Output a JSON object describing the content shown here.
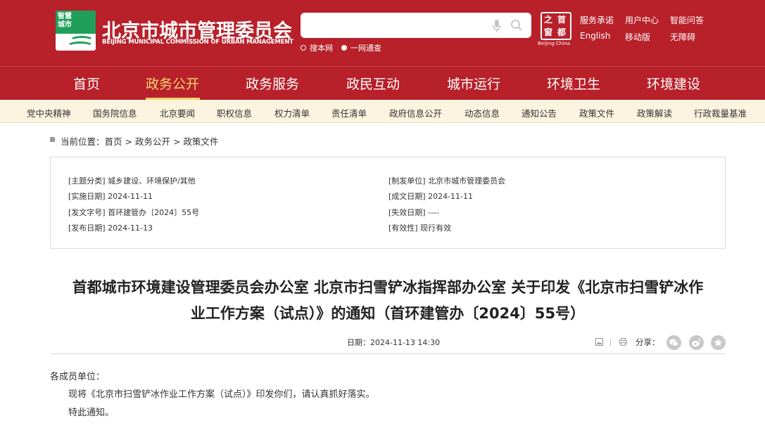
{
  "header": {
    "logo_text_line1": "智慧",
    "logo_text_line2": "城市",
    "site_name": "北京市城市管理委员会",
    "site_name_en": "BEIJING MUNICIPAL COMMISSION OF URBAN MANAGEMENT",
    "search_placeholder": "",
    "search_option_1": "搜本网",
    "search_option_2": "一网通查",
    "seal_chars": [
      "之",
      "首",
      "窗",
      "都"
    ],
    "seal_en": "Beijing·China",
    "links": [
      "服务承诺",
      "用户中心",
      "智能问答",
      "English",
      "移动版",
      "无障碍"
    ]
  },
  "main_nav": [
    "首页",
    "政务公开",
    "政务服务",
    "政民互动",
    "城市运行",
    "环境卫生",
    "环境建设"
  ],
  "main_nav_active": "政务公开",
  "sub_nav": [
    "党中央精神",
    "国务院信息",
    "北京要闻",
    "职权信息",
    "权力清单",
    "责任清单",
    "政府信息公开",
    "动态信息",
    "通知公告",
    "政策文件",
    "政策解读",
    "行政裁量基准"
  ],
  "breadcrumb": {
    "prefix": "当前位置：",
    "items": [
      "首页",
      "政务公开",
      "政策文件"
    ],
    "sep": " > "
  },
  "meta": {
    "left": [
      {
        "label": "[主题分类]",
        "value": "城乡建设、环境保护/其他"
      },
      {
        "label": "[实施日期]",
        "value": "2024-11-11"
      },
      {
        "label": "[发文字号]",
        "value": "首环建管办〔2024〕55号"
      },
      {
        "label": "[发布日期]",
        "value": "2024-11-13"
      }
    ],
    "right": [
      {
        "label": "[制发单位]",
        "value": "北京市城市管理委员会"
      },
      {
        "label": "[成文日期]",
        "value": "2024-11-11"
      },
      {
        "label": "[失效日期]",
        "value": "----"
      },
      {
        "label": "[有效性]",
        "value": "现行有效"
      }
    ]
  },
  "article": {
    "title_line1": "首都城市环境建设管理委员会办公室 北京市扫雪铲冰指挥部办公室 关于印发《北京市扫雪铲冰作",
    "title_line2": "业工作方案（试点）》的通知（首环建管办〔2024〕55号）",
    "date_label": "日期：",
    "date_value": "2024-11-13 14:30",
    "share_label": "分享：",
    "paragraphs": [
      "各成员单位：",
      "现将《北京市扫雪铲冰作业工作方案（试点）》印发你们，请认真抓好落实。",
      "特此通知。"
    ]
  },
  "colors": {
    "brand_red": "#b8202a",
    "nav_active": "#f3d66f",
    "sub_nav_bg": "#fdf4df",
    "logo_green": "#1f9f5a"
  }
}
